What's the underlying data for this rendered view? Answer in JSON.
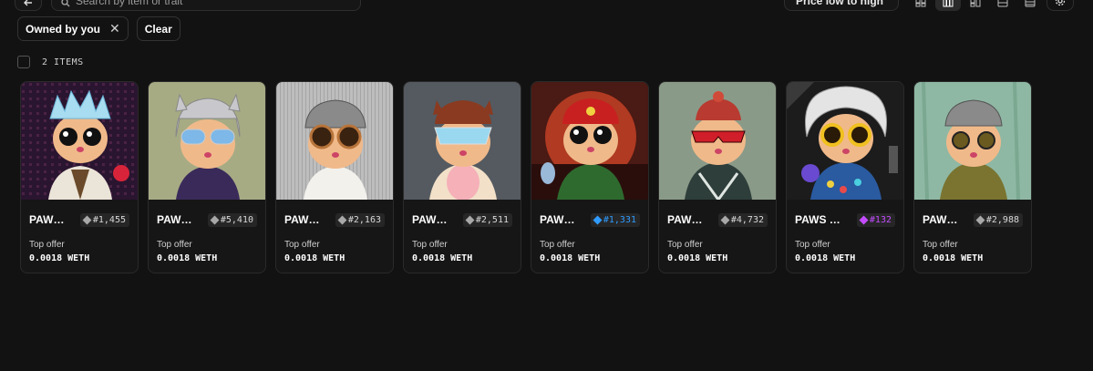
{
  "toolbar": {
    "search_placeholder": "Search by item or trait",
    "sort_label": "Price low to high",
    "icons": [
      "back-icon",
      "search-icon",
      "grid-small-icon",
      "grid-large-icon",
      "grid-mixed-icon",
      "list-icon",
      "table-icon",
      "settings-icon"
    ]
  },
  "filters": {
    "owned_chip": "Owned by you",
    "owned_chip_close": "✕",
    "clear": "Clear"
  },
  "items_count": "2 ITEMS",
  "cards": [
    {
      "name": "PAW…",
      "rank": "#1,455",
      "rank_color": "#a8a8a8",
      "offer_label": "Top offer",
      "offer_value": "0.0018 WETH"
    },
    {
      "name": "PAW…",
      "rank": "#5,410",
      "rank_color": "#a8a8a8",
      "offer_label": "Top offer",
      "offer_value": "0.0018 WETH"
    },
    {
      "name": "PAW…",
      "rank": "#2,163",
      "rank_color": "#a8a8a8",
      "offer_label": "Top offer",
      "offer_value": "0.0018 WETH"
    },
    {
      "name": "PAW…",
      "rank": "#2,511",
      "rank_color": "#a8a8a8",
      "offer_label": "Top offer",
      "offer_value": "0.0018 WETH"
    },
    {
      "name": "PAW…",
      "rank": "#1,331",
      "rank_color": "#2f9bff",
      "offer_label": "Top offer",
      "offer_value": "0.0018 WETH"
    },
    {
      "name": "PAW…",
      "rank": "#4,732",
      "rank_color": "#a8a8a8",
      "offer_label": "Top offer",
      "offer_value": "0.0018 WETH"
    },
    {
      "name": "PAWS …",
      "rank": "#132",
      "rank_color": "#c34cff",
      "offer_label": "Top offer",
      "offer_value": "0.0018 WETH"
    },
    {
      "name": "PAW…",
      "rank": "#2,988",
      "rank_color": "#a8a8a8",
      "offer_label": "Top offer",
      "offer_value": "0.0018 WETH"
    }
  ]
}
